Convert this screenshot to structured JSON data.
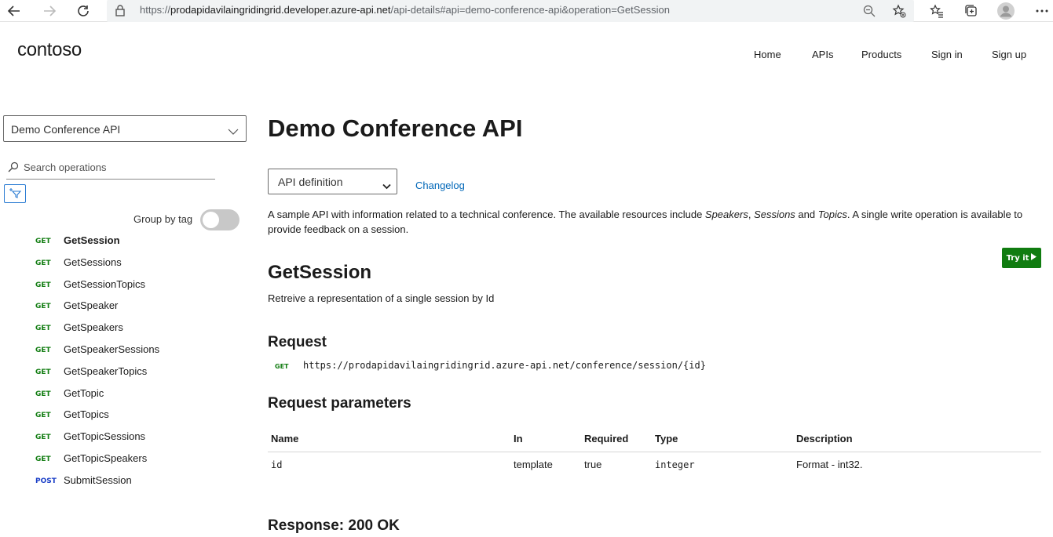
{
  "browser": {
    "url_scheme": "https://",
    "url_host": "prodapidavilaingridingrid.developer.azure-api.net",
    "url_path": "/api-details#api=demo-conference-api&operation=GetSession"
  },
  "site": {
    "logo": "contoso",
    "nav": [
      "Home",
      "APIs",
      "Products",
      "Sign in",
      "Sign up"
    ]
  },
  "sidebar": {
    "api_selected": "Demo Conference API",
    "search_placeholder": "Search operations",
    "group_by_tag_label": "Group by tag",
    "group_by_tag_on": false,
    "operations": [
      {
        "method": "GET",
        "name": "GetSession",
        "active": true
      },
      {
        "method": "GET",
        "name": "GetSessions"
      },
      {
        "method": "GET",
        "name": "GetSessionTopics"
      },
      {
        "method": "GET",
        "name": "GetSpeaker"
      },
      {
        "method": "GET",
        "name": "GetSpeakers"
      },
      {
        "method": "GET",
        "name": "GetSpeakerSessions"
      },
      {
        "method": "GET",
        "name": "GetSpeakerTopics"
      },
      {
        "method": "GET",
        "name": "GetTopic"
      },
      {
        "method": "GET",
        "name": "GetTopics"
      },
      {
        "method": "GET",
        "name": "GetTopicSessions"
      },
      {
        "method": "GET",
        "name": "GetTopicSpeakers"
      },
      {
        "method": "POST",
        "name": "SubmitSession"
      }
    ]
  },
  "main": {
    "title": "Demo Conference API",
    "definition_select": "API definition",
    "changelog": "Changelog",
    "description": {
      "part1": "A sample API with information related to a technical conference. The available resources include ",
      "em1": "Speakers",
      "sep1": ", ",
      "em2": "Sessions",
      "sep2": " and ",
      "em3": "Topics",
      "part2": ". A single write operation is available to provide feedback on a session."
    },
    "try_it": "Try it",
    "operation_title": "GetSession",
    "operation_desc": "Retreive a representation of a single session by Id",
    "request_heading": "Request",
    "request_method": "GET",
    "request_url": "https://prodapidavilaingridingrid.azure-api.net/conference/session/{id}",
    "params_heading": "Request parameters",
    "params_columns": [
      "Name",
      "In",
      "Required",
      "Type",
      "Description"
    ],
    "params_rows": [
      {
        "name": "id",
        "in": "template",
        "required": "true",
        "type": "integer",
        "description": "Format - int32."
      }
    ],
    "response_heading": "Response: 200 OK"
  },
  "colors": {
    "get": "#107c10",
    "post": "#1a3ec7",
    "link": "#0067b8",
    "try_it": "#107c10"
  }
}
